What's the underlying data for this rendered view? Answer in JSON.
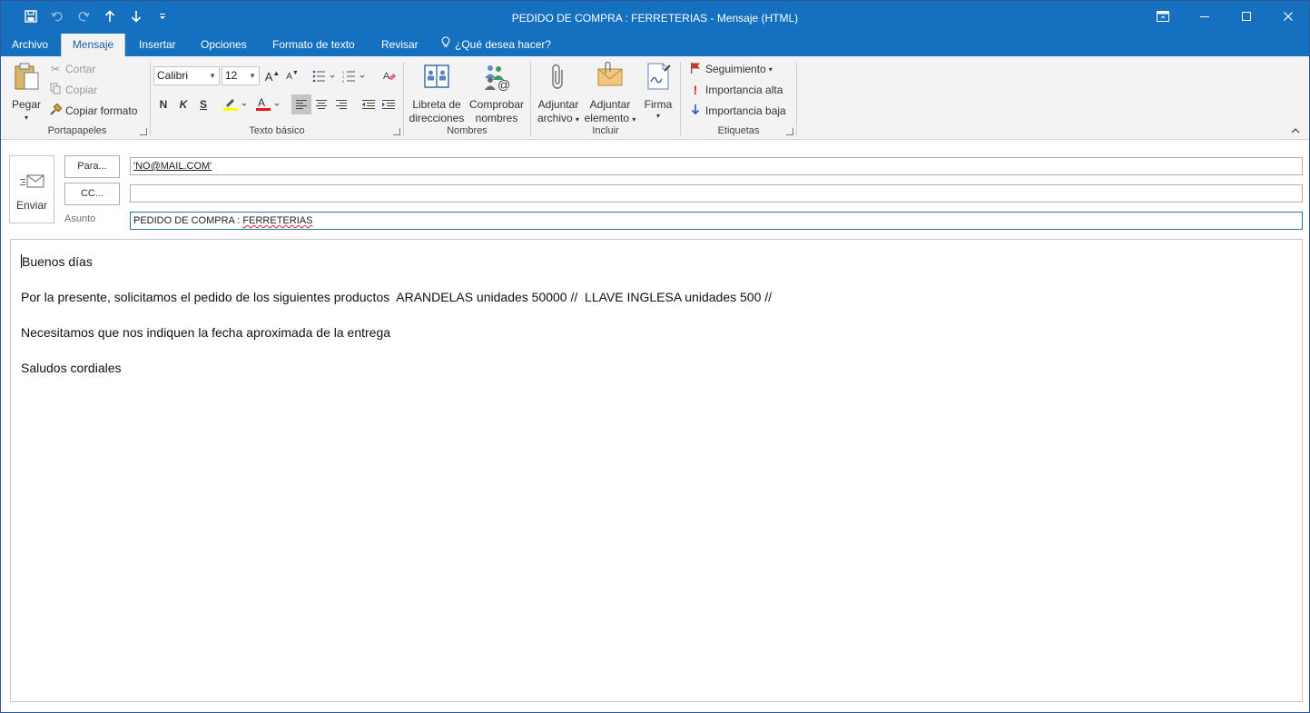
{
  "window": {
    "title": "PEDIDO DE COMPRA : FERRETERIAS - Mensaje (HTML)"
  },
  "qat": {
    "icons": [
      "save-icon",
      "undo-icon",
      "redo-icon",
      "up-arrow-icon",
      "down-arrow-icon",
      "customize-qat-icon"
    ]
  },
  "tabs": {
    "archivo": "Archivo",
    "mensaje": "Mensaje",
    "insertar": "Insertar",
    "opciones": "Opciones",
    "formato": "Formato de texto",
    "revisar": "Revisar",
    "tellme": "¿Qué desea hacer?"
  },
  "ribbon": {
    "portapapeles": {
      "label": "Portapapeles",
      "pegar": "Pegar",
      "cortar": "Cortar",
      "copiar": "Copiar",
      "copiar_formato": "Copiar formato"
    },
    "texto_basico": {
      "label": "Texto básico",
      "font": "Calibri",
      "size": "12",
      "bold": "N",
      "italic": "K",
      "underline": "S"
    },
    "nombres": {
      "label": "Nombres",
      "libreta_1": "Libreta de",
      "libreta_2": "direcciones",
      "comprobar_1": "Comprobar",
      "comprobar_2": "nombres"
    },
    "incluir": {
      "label": "Incluir",
      "adjuntar_archivo_1": "Adjuntar",
      "adjuntar_archivo_2": "archivo",
      "adjuntar_elemento_1": "Adjuntar",
      "adjuntar_elemento_2": "elemento",
      "firma": "Firma"
    },
    "etiquetas": {
      "label": "Etiquetas",
      "seguimiento": "Seguimiento",
      "importancia_alta": "Importancia alta",
      "importancia_baja": "Importancia baja"
    }
  },
  "compose": {
    "enviar": "Enviar",
    "para_btn": "Para...",
    "cc_btn": "CC...",
    "para_value": "'NO@MAIL.COM'",
    "cc_value": "",
    "asunto_label": "Asunto",
    "asunto_prefix": "PEDIDO DE COMPRA : ",
    "asunto_word": "FERRETERIAS"
  },
  "body": {
    "lines": [
      "Buenos días",
      "Por la presente, solicitamos el pedido de los siguientes productos  ARANDELAS unidades 50000 //  LLAVE INGLESA unidades 500 //",
      "Necesitamos que nos indiquen la fecha aproximada de la entrega",
      "Saludos cordiales"
    ]
  },
  "colors": {
    "titlebar": "#1570c0",
    "ribbon": "#f3f3f3",
    "active_tab_text": "#1f5ba6",
    "font_color_underline": "#e8141c",
    "highlight_underline": "#ffff00",
    "flag": "#c0392b",
    "importance_high": "#d32f2f",
    "importance_low": "#1e5bb8"
  }
}
